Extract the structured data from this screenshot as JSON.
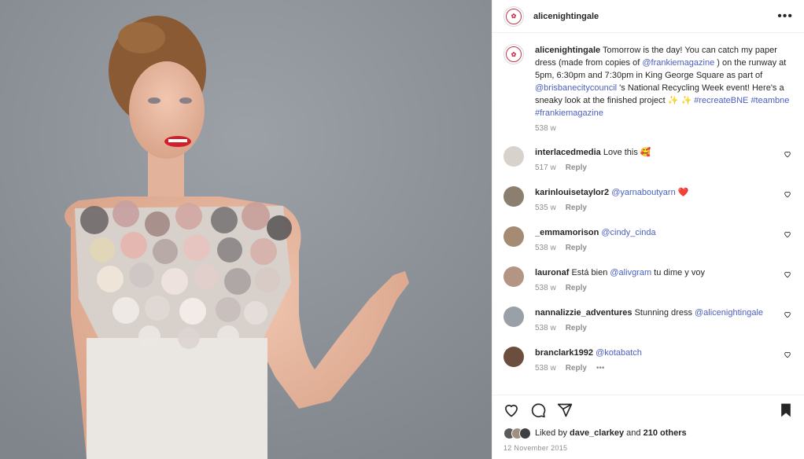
{
  "post": {
    "username": "alicenightingale",
    "caption_parts": {
      "t1": "Tomorrow is the day! You can catch my paper dress (made from copies of ",
      "m1": "@frankiemagazine",
      "t2": " ) on the runway at 5pm, 6:30pm and 7:30pm in King George Square as part of ",
      "m2": "@brisbanecitycouncil",
      "t3": " 's National Recycling Week event! Here's a sneaky look at the finished project ",
      "sparkles": "✨ ✨",
      "h1": "#recreateBNE",
      "h2": "#teambne",
      "h3": "#frankiemagazine"
    },
    "time": "538 w"
  },
  "comments": [
    {
      "user": "interlacedmedia",
      "text": "Love this ",
      "emoji": "🥰",
      "time": "517 w",
      "reply": "Reply",
      "color": "#d7d2cc"
    },
    {
      "user": "karinlouisetaylor2",
      "mention": "@yarnaboutyarn",
      "emoji": "❤️",
      "time": "535 w",
      "reply": "Reply",
      "color": "#8c7f70"
    },
    {
      "user": "_emmamorison",
      "mention": "@cindy_cinda",
      "time": "538 w",
      "reply": "Reply",
      "color": "#a58a74"
    },
    {
      "user": "lauronaf",
      "text": "Está bien ",
      "mention": "@alivgram",
      "text2": " tu dime y voy",
      "time": "538 w",
      "reply": "Reply",
      "color": "#b49482"
    },
    {
      "user": "nannalizzie_adventures",
      "text": "Stunning dress ",
      "mention": "@alicenightingale",
      "time": "538 w",
      "reply": "Reply",
      "color": "#9aa0a8"
    },
    {
      "user": "branclark1992",
      "mention": "@kotabatch",
      "time": "538 w",
      "reply": "Reply",
      "more": "•••",
      "color": "#6b4e3d"
    }
  ],
  "likes": {
    "prefix": "Liked by ",
    "user": "dave_clarkey",
    "mid": " and ",
    "count": "210 others"
  },
  "date": "12 November 2015",
  "colors": {
    "accent": "#4a5fc1",
    "muted": "#8e8e8e",
    "text": "#262626"
  }
}
